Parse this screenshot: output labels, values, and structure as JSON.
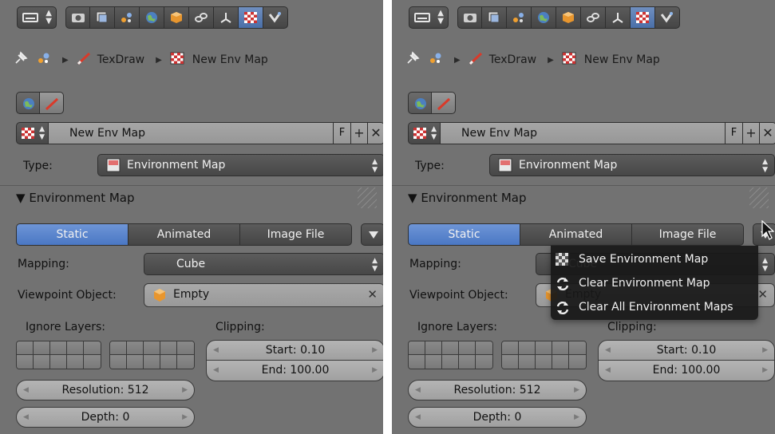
{
  "breadcrumb": {
    "material": "TexDraw",
    "texture": "New Env Map"
  },
  "texture": {
    "name": "New Env Map",
    "fake_user": "F",
    "add": "+",
    "unlink": "✕"
  },
  "type": {
    "label": "Type:",
    "value": "Environment Map"
  },
  "panel": {
    "title": "Environment Map",
    "modes": [
      "Static",
      "Animated",
      "Image File"
    ],
    "active_mode": "Static",
    "mapping": {
      "label": "Mapping:",
      "value": "Cube"
    },
    "viewpoint": {
      "label": "Viewpoint Object:",
      "value": "Empty"
    },
    "ignore_layers_label": "Ignore Layers:",
    "clipping_label": "Clipping:",
    "clip_start": "Start: 0.10",
    "clip_end": "End: 100.00",
    "resolution": "Resolution: 512",
    "depth": "Depth: 0"
  },
  "menu": {
    "items": [
      "Save Environment Map",
      "Clear Environment Map",
      "Clear All Environment Maps"
    ],
    "mnemonics": [
      "S",
      "C",
      "A"
    ]
  },
  "colors": {
    "panel_bg": "#727272",
    "active_blue": "#5b86cf",
    "menu_bg": "#181818"
  }
}
